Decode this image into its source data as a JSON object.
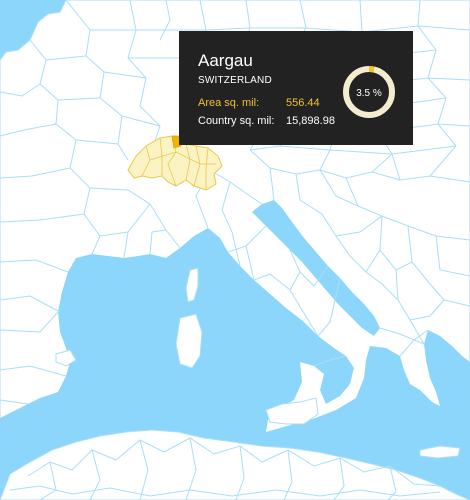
{
  "map": {
    "colors": {
      "water": "#8bd6fa",
      "land": "#ffffff",
      "border": "#a9def7",
      "highlight_fill": "#fbf3c4",
      "highlight_border": "#e8c84a",
      "selected_region": "#f2b400"
    },
    "highlighted_country": "Switzerland",
    "selected_region": "Aargau"
  },
  "tooltip": {
    "region_name": "Aargau",
    "country_name": "SWITZERLAND",
    "area_label": "Area sq. mil:",
    "area_value": "556.44",
    "country_label": "Country sq. mil:",
    "country_value": "15,898.98",
    "percent_label": "3.5 %",
    "percent_value": 3.5,
    "colors": {
      "background": "#222222",
      "accent": "#f2c12e",
      "ring": "#f3ecd0"
    }
  }
}
